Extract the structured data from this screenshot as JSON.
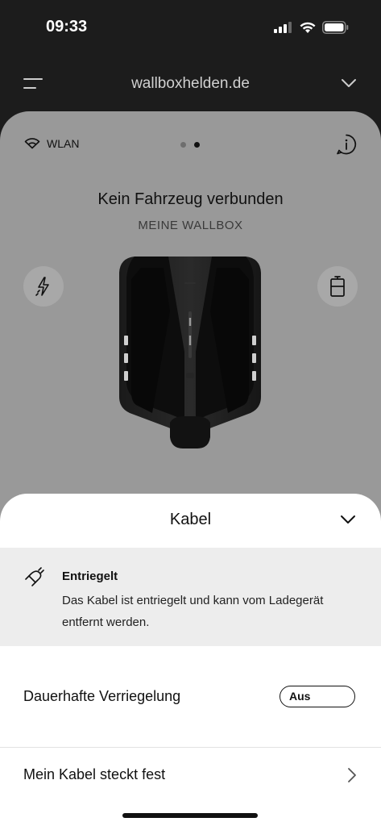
{
  "status_bar": {
    "time": "09:33",
    "icons": [
      "cellular-signal-icon",
      "wifi-icon",
      "battery-icon"
    ]
  },
  "header": {
    "title": "wallboxhelden.de",
    "menu_icon": "menu-icon",
    "chevron_icon": "chevron-down-icon"
  },
  "card": {
    "connection_label": "WLAN",
    "page_indicator": {
      "count": 2,
      "active_index": 1
    },
    "status_title": "Kein Fahrzeug verbunden",
    "device_name": "MEINE WALLBOX",
    "left_button_icon": "charging-lightning-icon",
    "right_button_icon": "battery-level-icon"
  },
  "sheet": {
    "title": "Kabel",
    "info": {
      "heading": "Entriegelt",
      "text": "Das Kabel ist entriegelt und kann vom Ladegerät entfernt werden."
    },
    "permanent_lock": {
      "label": "Dauerhafte Verriegelung",
      "value": "Aus"
    },
    "stuck_cable": {
      "label": "Mein Kabel steckt fest"
    }
  },
  "colors": {
    "background": "#1c1c1c",
    "card": "#999999",
    "sheet": "#ffffff",
    "info_panel": "#ededed"
  }
}
